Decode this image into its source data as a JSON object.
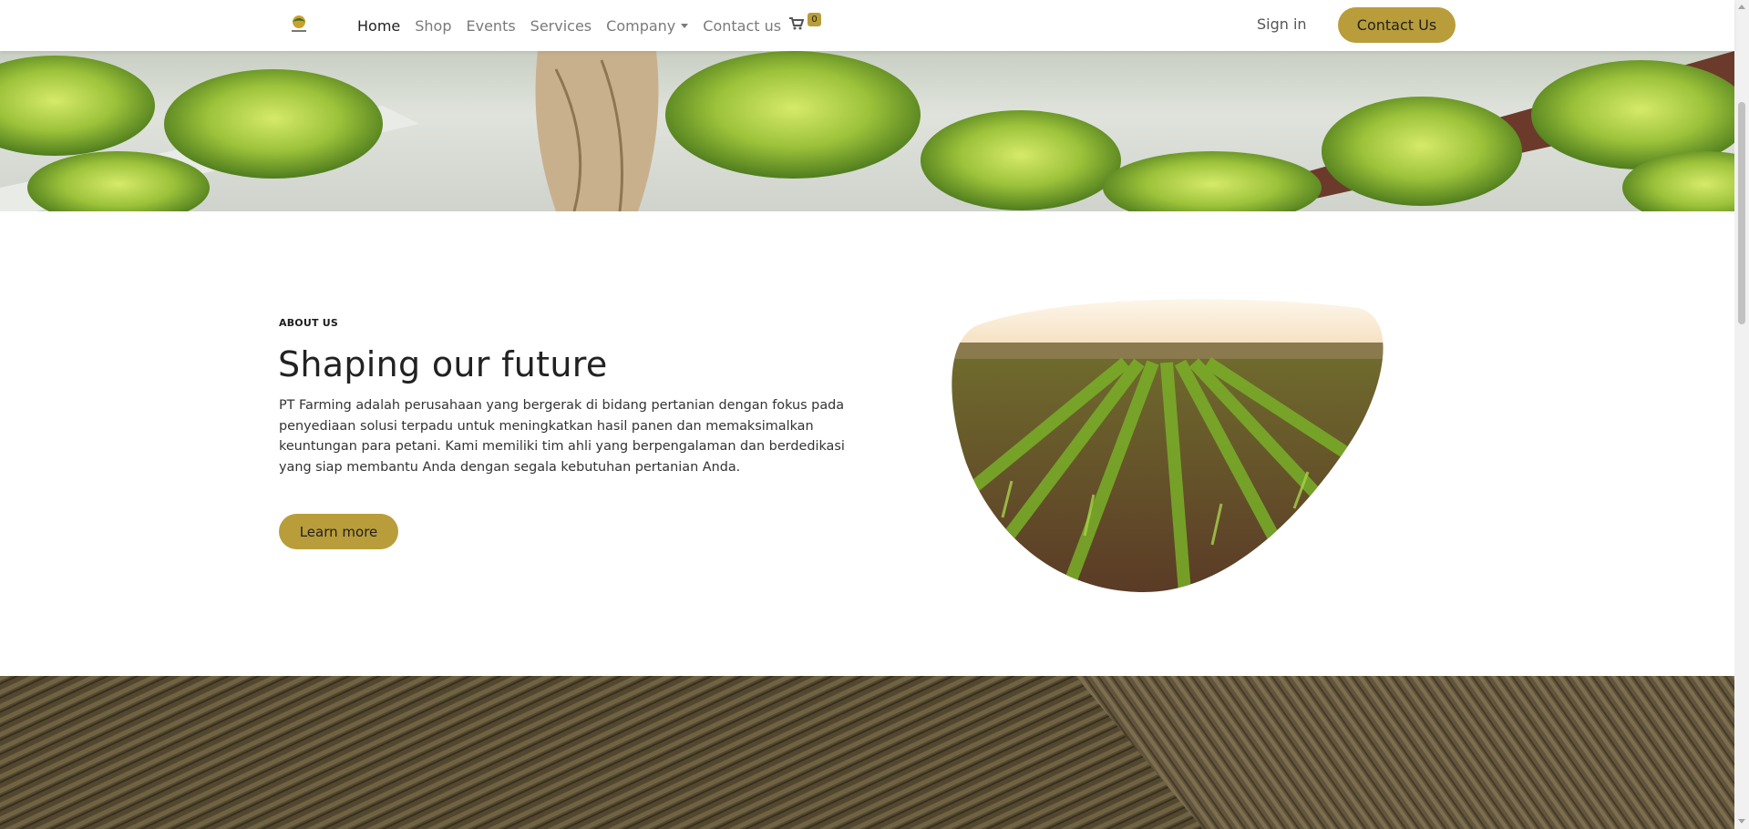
{
  "nav": {
    "logo": "pt-farming-logo",
    "links": [
      {
        "label": "Home"
      },
      {
        "label": "Shop"
      },
      {
        "label": "Events"
      },
      {
        "label": "Services"
      },
      {
        "label": "Company"
      },
      {
        "label": "Contact us"
      }
    ],
    "cart_count": "0",
    "signin_label": "Sign in",
    "contact_label": "Contact Us"
  },
  "about": {
    "kicker": "ABOUT US",
    "title": "Shaping our future",
    "text": "PT Farming adalah perusahaan yang bergerak di bidang pertanian dengan fokus pada penyediaan solusi terpadu untuk meningkatkan hasil panen dan memaksimalkan keuntungan para petani. Kami memiliki tim ahli yang berpengalaman dan berdedikasi yang siap membantu Anda dengan segala kebutuhan pertanian Anda.",
    "button_label": "Learn more"
  },
  "colors": {
    "accent": "#b99d3a",
    "text": "#222222"
  }
}
